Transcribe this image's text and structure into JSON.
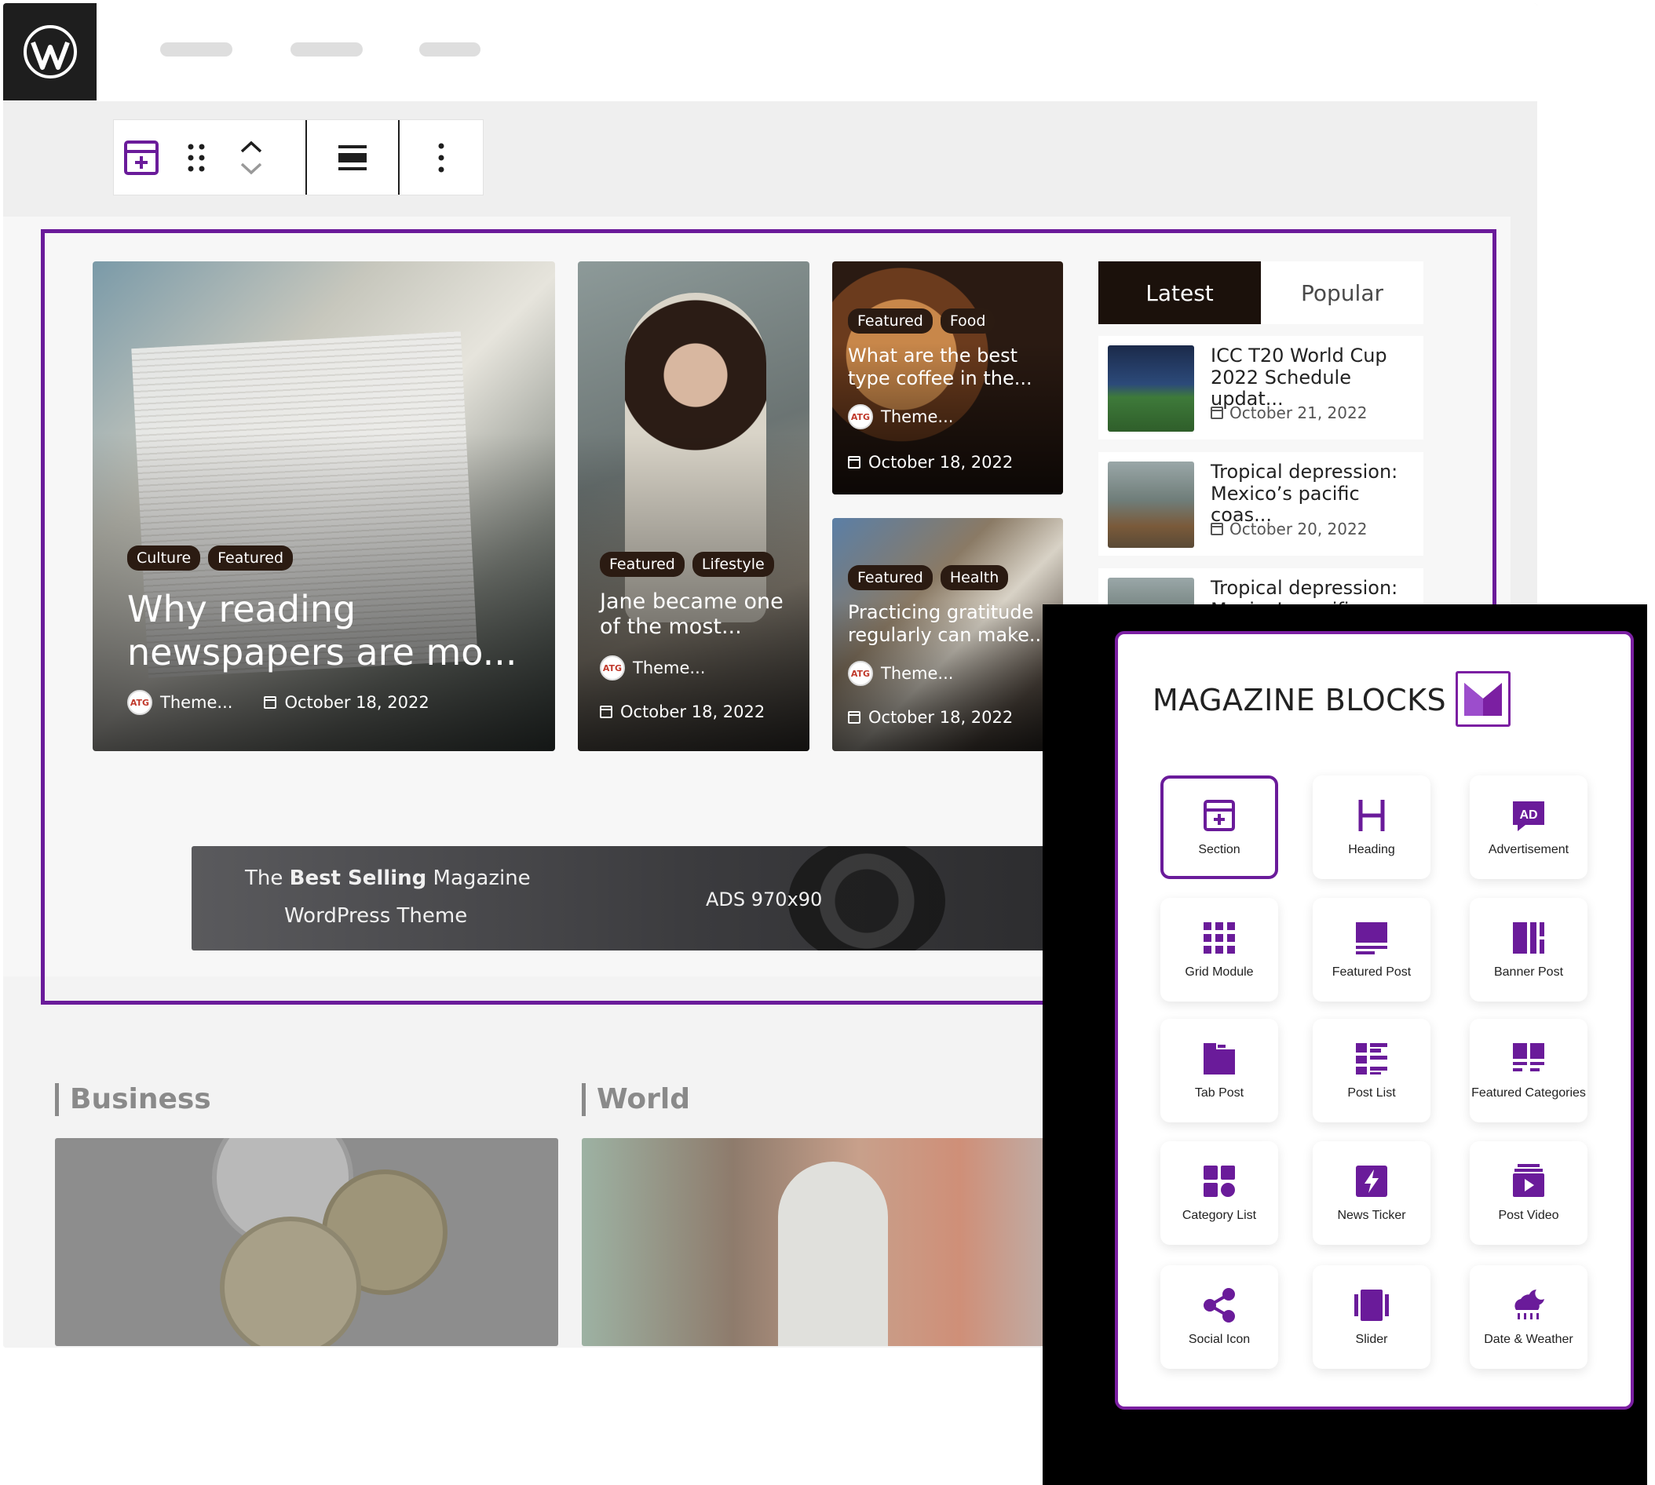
{
  "colors": {
    "accent": "#6a1b9a",
    "panel_border": "#7b1fa2",
    "tag_bg": "#2b1b12",
    "tab_active_bg": "#1b110b"
  },
  "editor": {
    "logo_icon": "wordpress-icon",
    "toolbar_icons": [
      "section-block-icon",
      "drag-handle-icon",
      "move-up-icon",
      "move-down-icon",
      "align-icon",
      "more-options-icon"
    ]
  },
  "cards": [
    {
      "tags": [
        "Culture",
        "Featured"
      ],
      "title": "Why reading newspapers are mo...",
      "author": "Theme...",
      "date": "October 18, 2022"
    },
    {
      "tags": [
        "Featured",
        "Lifestyle"
      ],
      "title": "Jane became one of the most...",
      "author": "Theme...",
      "date": "October 18, 2022"
    },
    {
      "tags": [
        "Featured",
        "Food"
      ],
      "title": "What are the best type coffee in the...",
      "author": "Theme...",
      "date": "October 18, 2022"
    },
    {
      "tags": [
        "Featured",
        "Health"
      ],
      "title": "Practicing gratitude regularly can make...",
      "author": "Theme...",
      "date": "October 18, 2022"
    }
  ],
  "avatar_text": "ATG",
  "tabs": {
    "latest": "Latest",
    "popular": "Popular"
  },
  "latest_list": [
    {
      "title": "ICC T20 World Cup 2022 Schedule updat...",
      "date": "October 21, 2022"
    },
    {
      "title": "Tropical depression: Mexico’s pacific coas...",
      "date": "October 20, 2022"
    },
    {
      "title": "Tropical depression: Mexico’s pacific coas...",
      "date": ""
    }
  ],
  "ad": {
    "line1_pre": "The ",
    "line1_bold": "Best Selling",
    "line1_post": " Magazine",
    "line2": "WordPress Theme",
    "size": "ADS 970x90"
  },
  "categories": {
    "business": "Business",
    "world": "World"
  },
  "panel": {
    "title": "MAGAZINE BLOCKS",
    "blocks": [
      {
        "label": "Section",
        "icon": "section-icon",
        "active": true
      },
      {
        "label": "Heading",
        "icon": "heading-icon",
        "active": false
      },
      {
        "label": "Advertisement",
        "icon": "advertisement-icon",
        "active": false
      },
      {
        "label": "Grid Module",
        "icon": "grid-module-icon",
        "active": false
      },
      {
        "label": "Featured Post",
        "icon": "featured-post-icon",
        "active": false
      },
      {
        "label": "Banner Post",
        "icon": "banner-post-icon",
        "active": false
      },
      {
        "label": "Tab Post",
        "icon": "tab-post-icon",
        "active": false
      },
      {
        "label": "Post List",
        "icon": "post-list-icon",
        "active": false
      },
      {
        "label": "Featured Categories",
        "icon": "featured-categories-icon",
        "active": false
      },
      {
        "label": "Category List",
        "icon": "category-list-icon",
        "active": false
      },
      {
        "label": "News Ticker",
        "icon": "news-ticker-icon",
        "active": false
      },
      {
        "label": "Post Video",
        "icon": "post-video-icon",
        "active": false
      },
      {
        "label": "Social Icon",
        "icon": "social-icon",
        "active": false
      },
      {
        "label": "Slider",
        "icon": "slider-icon",
        "active": false
      },
      {
        "label": "Date & Weather",
        "icon": "date-weather-icon",
        "active": false
      }
    ]
  }
}
